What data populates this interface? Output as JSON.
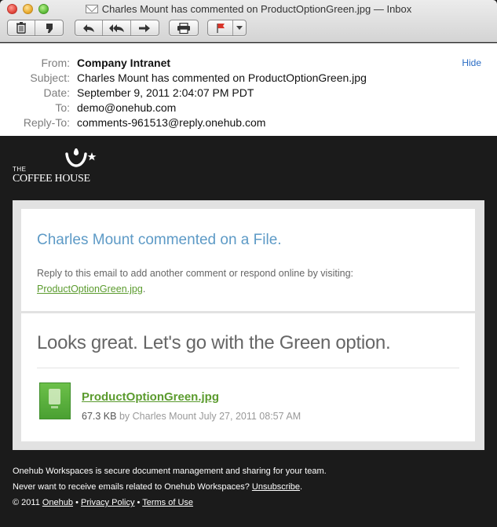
{
  "window": {
    "title": "Charles Mount has commented on ProductOptionGreen.jpg — Inbox"
  },
  "toolbar": {
    "icons": [
      "trash-icon",
      "junk-icon",
      "reply-icon",
      "reply-all-icon",
      "forward-icon",
      "print-icon",
      "flag-icon",
      "chevron-down-icon"
    ]
  },
  "headers": {
    "from_label": "From:",
    "from_value": "Company Intranet",
    "subject_label": "Subject:",
    "subject_value": "Charles Mount has commented on ProductOptionGreen.jpg",
    "date_label": "Date:",
    "date_value": "September 9, 2011 2:04:07 PM PDT",
    "to_label": "To:",
    "to_value": "demo@onehub.com",
    "replyto_label": "Reply-To:",
    "replyto_value": "comments-961513@reply.onehub.com",
    "hide_label": "Hide"
  },
  "brand": {
    "logo_small": "THE",
    "logo_big": "COFFEE HOUSE"
  },
  "notice": {
    "title": "Charles Mount commented on a File.",
    "text": "Reply to this email to add another comment or respond online by visiting:",
    "link": "ProductOptionGreen.jpg",
    "link_suffix": "."
  },
  "comment": {
    "text": "Looks great. Let's go with the Green option.",
    "file_name": "ProductOptionGreen.jpg",
    "file_size": "67.3 KB",
    "by_text": " by Charles Mount July 27, 2011 08:57 AM"
  },
  "footer": {
    "line1": "Onehub Workspaces is secure document management and sharing for your team.",
    "line2_prefix": "Never want to receive emails related to Onehub Workspaces? ",
    "unsubscribe": "Unsubscribe",
    "line2_suffix": ".",
    "copyright": "© 2011 ",
    "onehub": "Onehub",
    "sep": " • ",
    "privacy": "Privacy Policy",
    "terms": "Terms of Use"
  },
  "colors": {
    "accent_link": "#2a6cc4",
    "title_blue": "#5d9ac6",
    "green_link": "#5b9b2e",
    "body_bg": "#1b1b1b"
  }
}
